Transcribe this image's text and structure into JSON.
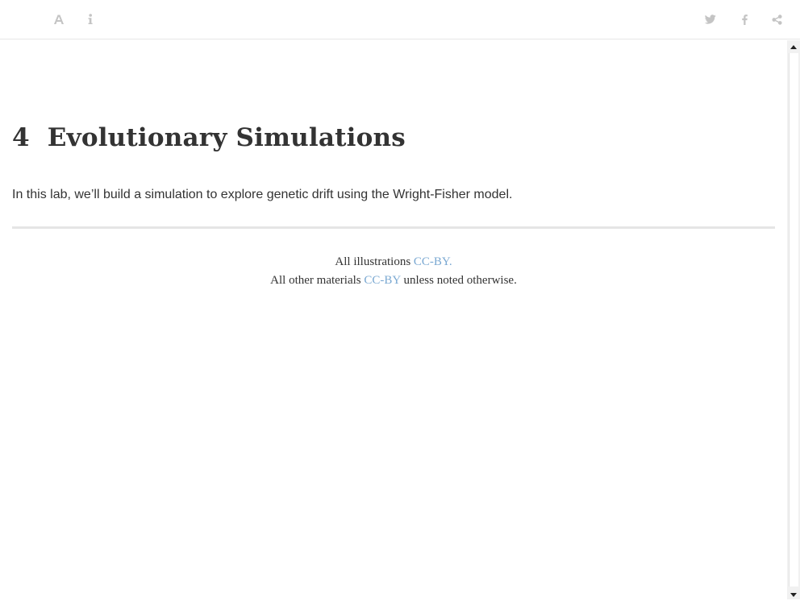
{
  "toolbar": {
    "left_icons": [
      "font-settings-icon",
      "info-icon"
    ],
    "right_icons": [
      "twitter-icon",
      "facebook-icon",
      "share-icon"
    ]
  },
  "chapter": {
    "number": "4",
    "title": "Evolutionary Simulations",
    "intro": "In this lab, we’ll build a simulation to explore genetic drift using the Wright-Fisher model."
  },
  "footer": {
    "line1_text": "All illustrations ",
    "line1_link": "CC-BY.",
    "line2_text": "All other materials ",
    "line2_link": "CC-BY",
    "line2_suffix": " unless noted otherwise."
  },
  "colors": {
    "text": "#333333",
    "link": "#7aa8d2",
    "icon": "#c4c4c4",
    "rule": "#e5e5e5"
  },
  "scrollbar": {
    "up_arrow": "▲",
    "down_arrow": "▼"
  }
}
